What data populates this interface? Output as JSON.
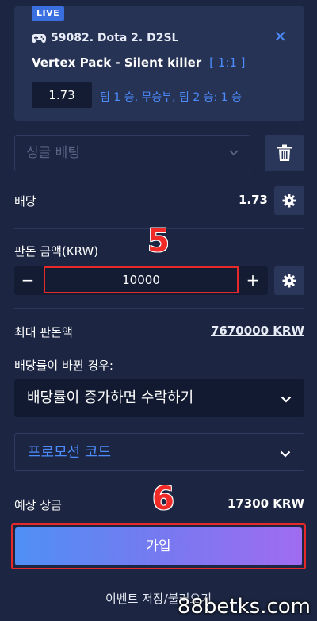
{
  "bet_card": {
    "live_badge": "LIVE",
    "event": "59082. Dota 2. D2SL",
    "market": "Vertex Pack - Silent killer",
    "market_tag": "[ 1:1 ]",
    "odds": "1.73",
    "outcome": "팀 1 승, 무승부, 팀 2 승: 1 승"
  },
  "bet_type": {
    "placeholder": "싱글 베팅"
  },
  "odds_row": {
    "label": "배당",
    "value": "1.73"
  },
  "stake": {
    "label": "판돈 금액(KRW)",
    "value": "10000",
    "minus": "−",
    "plus": "+"
  },
  "max_stake": {
    "label": "최대 판돈액",
    "value": "7670000 KRW"
  },
  "odds_change": {
    "label": "배당률이 바뀐 경우:",
    "selected": "배당률이 증가하면 수락하기"
  },
  "promo": {
    "placeholder": "프로모션 코드"
  },
  "winnings": {
    "label": "예상 상금",
    "value": "17300 KRW"
  },
  "register_label": "가입",
  "footer_link": "이벤트 저장/불러오기",
  "annotations": {
    "step5": "5",
    "step6": "6"
  },
  "watermark": "88betks.com",
  "icons": [
    "gamepad-icon",
    "close-icon",
    "chevron-down-icon",
    "trash-icon",
    "gear-icon"
  ],
  "colors": {
    "accent": "#4d8cff",
    "highlight": "#e6292b",
    "background": "#1c2642"
  }
}
